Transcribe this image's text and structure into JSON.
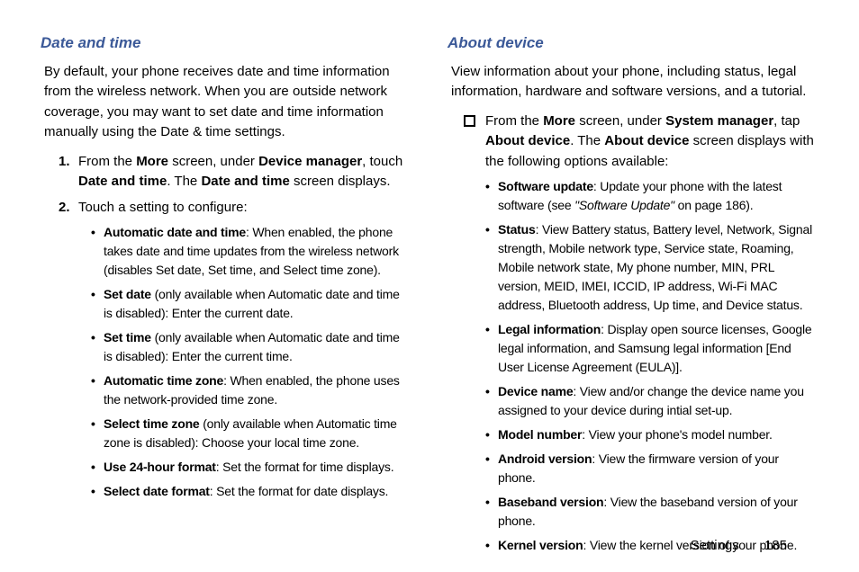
{
  "left": {
    "heading": "Date and time",
    "intro": "By default, your phone receives date and time information from the wireless network. When you are outside network coverage, you may want to set date and time information manually using the Date & time settings.",
    "step1": {
      "p1": "From the ",
      "b1": "More",
      "p2": " screen, under ",
      "b2": "Device manager",
      "p3": ", touch ",
      "b3": "Date and time",
      "p4": ". The ",
      "b4": "Date and time",
      "p5": " screen displays."
    },
    "step2_label": "Touch a setting to configure:",
    "bullets": [
      {
        "b": "Automatic date and time",
        "rest": ": When enabled, the phone takes date and time updates from the wireless network (disables Set date, Set time, and Select time zone)."
      },
      {
        "b": "Set date",
        "rest": " (only available when Automatic date and time is disabled): Enter the current date."
      },
      {
        "b": "Set time",
        "rest": " (only available when Automatic date and time is disabled): Enter the current time."
      },
      {
        "b": "Automatic time zone",
        "rest": ": When enabled, the phone uses the network-provided time zone."
      },
      {
        "b": "Select time zone",
        "rest": " (only available when Automatic time zone is disabled): Choose your local time zone."
      },
      {
        "b": "Use 24-hour format",
        "rest": ": Set the format for time displays."
      },
      {
        "b": "Select date format",
        "rest": ": Set the format for date displays."
      }
    ]
  },
  "right": {
    "heading": "About device",
    "intro": "View information about your phone, including status, legal information, hardware and software versions, and a tutorial.",
    "sq": {
      "p1": "From the ",
      "b1": "More",
      "p2": " screen, under ",
      "b2": "System manager",
      "p3": ", tap ",
      "b3": "About device",
      "p4": ". The ",
      "b4": "About device",
      "p5": " screen displays with the following options available:"
    },
    "bullets": [
      {
        "b": "Software update",
        "rest": ": Update your phone with the latest software (see ",
        "i": "\"Software Update\"",
        "rest2": " on page 186)."
      },
      {
        "b": "Status",
        "rest": ": View Battery status, Battery level, Network, Signal strength, Mobile network type, Service state, Roaming, Mobile network state, My phone number, MIN, PRL version, MEID, IMEI, ICCID, IP address, Wi-Fi MAC address, Bluetooth address, Up time, and Device status."
      },
      {
        "b": "Legal information",
        "rest": ": Display open source licenses, Google legal information, and Samsung legal information [End User License Agreement (EULA)]."
      },
      {
        "b": "Device name",
        "rest": ": View and/or change the device name you assigned to your device during intial set-up."
      },
      {
        "b": "Model number",
        "rest": ": View your phone's model number."
      },
      {
        "b": "Android version",
        "rest": ": View the firmware version of your phone."
      },
      {
        "b": "Baseband version",
        "rest": ": View the baseband version of your phone."
      },
      {
        "b": "Kernel version",
        "rest": ": View the kernel version of your phone."
      }
    ]
  },
  "footer": {
    "section": "Settings",
    "page": "185"
  }
}
